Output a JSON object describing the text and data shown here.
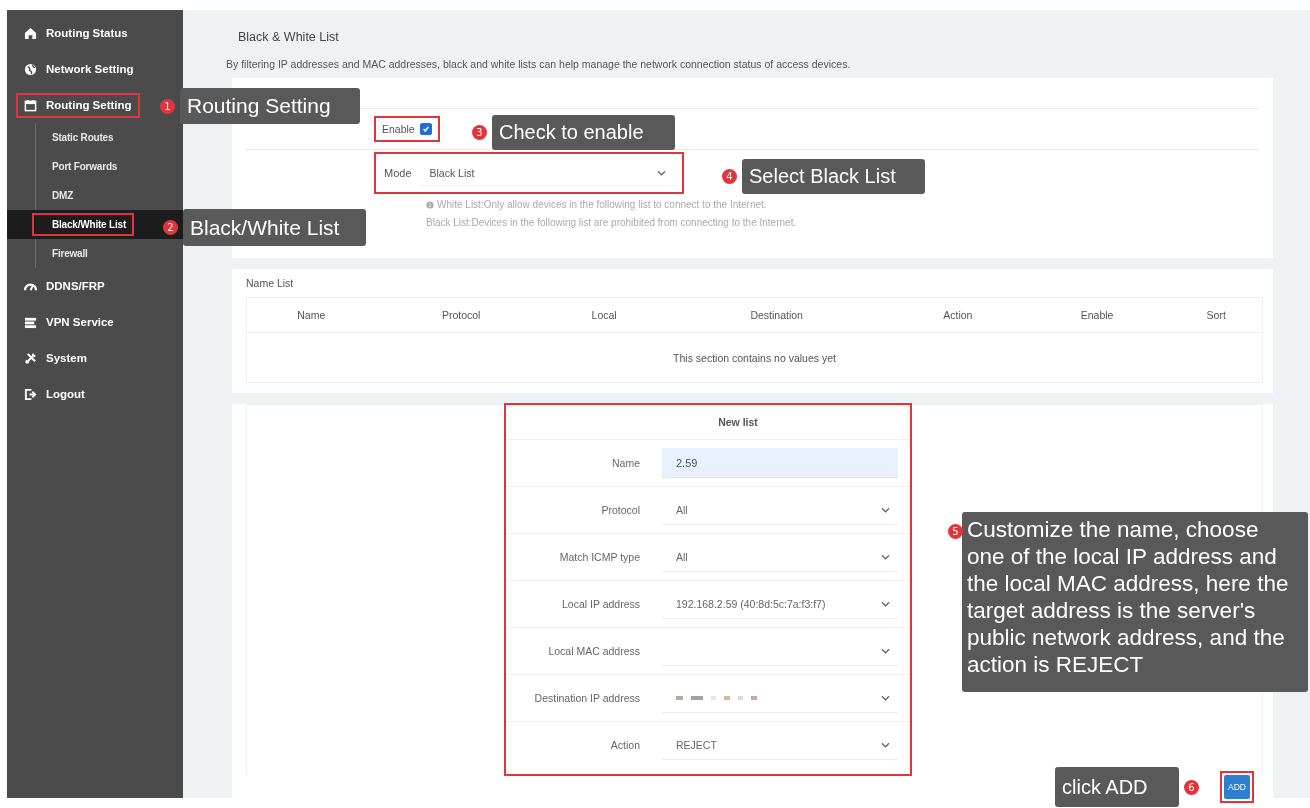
{
  "sidebar": {
    "items": [
      {
        "label": "Routing Status",
        "highlighted": false
      },
      {
        "label": "Network Setting",
        "highlighted": false
      },
      {
        "label": "Routing Setting",
        "highlighted": true,
        "expanded": true,
        "children": [
          {
            "label": "Static Routes",
            "selected": false,
            "highlighted": false
          },
          {
            "label": "Port Forwards",
            "selected": false,
            "highlighted": false
          },
          {
            "label": "DMZ",
            "selected": false,
            "highlighted": false
          },
          {
            "label": "Black/White List",
            "selected": true,
            "highlighted": true
          },
          {
            "label": "Firewall",
            "selected": false,
            "highlighted": false
          }
        ]
      },
      {
        "label": "DDNS/FRP",
        "highlighted": false
      },
      {
        "label": "VPN Service",
        "highlighted": false
      },
      {
        "label": "System",
        "highlighted": false
      },
      {
        "label": "Logout",
        "highlighted": false
      }
    ]
  },
  "page": {
    "title": "Black & White List",
    "description": "By filtering IP addresses and MAC addresses, black and white lists can help manage the network connection status of access devices."
  },
  "mode_config": {
    "enable": {
      "label": "Enable",
      "checked": true,
      "highlighted": true
    },
    "mode": {
      "label": "Mode",
      "value": "Black List",
      "highlighted": true
    },
    "hints": [
      "White List:Only allow devices in the following list to connect to the Internet.",
      "Black List:Devices in the following list are prohibited from connecting to the Internet."
    ]
  },
  "name_list": {
    "title": "Name List",
    "columns": [
      "Name",
      "Protocol",
      "Local",
      "Destination",
      "Action",
      "Enable",
      "Sort"
    ],
    "empty_message": "This section contains no values yet"
  },
  "new_list": {
    "title": "New list",
    "highlighted": true,
    "fields": [
      {
        "label": "Name",
        "kind": "input",
        "value": "2.59",
        "focused": true
      },
      {
        "label": "Protocol",
        "kind": "select",
        "value": "All"
      },
      {
        "label": "Match ICMP type",
        "kind": "select",
        "value": "All"
      },
      {
        "label": "Local IP address",
        "kind": "select",
        "value": "192.168.2.59 (40:8d:5c:7a:f3:f7)"
      },
      {
        "label": "Local MAC address",
        "kind": "select"
      },
      {
        "label": "Destination IP address",
        "kind": "select",
        "redacted": true
      },
      {
        "label": "Action",
        "kind": "select",
        "value": "REJECT"
      }
    ],
    "add_button": {
      "label": "ADD",
      "highlighted": true
    }
  },
  "annotations": [
    {
      "number": "1",
      "text": "Routing Setting"
    },
    {
      "number": "2",
      "text": "Black/White List"
    },
    {
      "number": "3",
      "text": "Check to enable"
    },
    {
      "number": "4",
      "text": "Select Black List"
    },
    {
      "number": "5",
      "text": "Customize the name, choose one of the local IP address and the local MAC address, here the target address is the server's public network address, and the action is REJECT"
    },
    {
      "number": "6",
      "text": "click ADD"
    }
  ]
}
